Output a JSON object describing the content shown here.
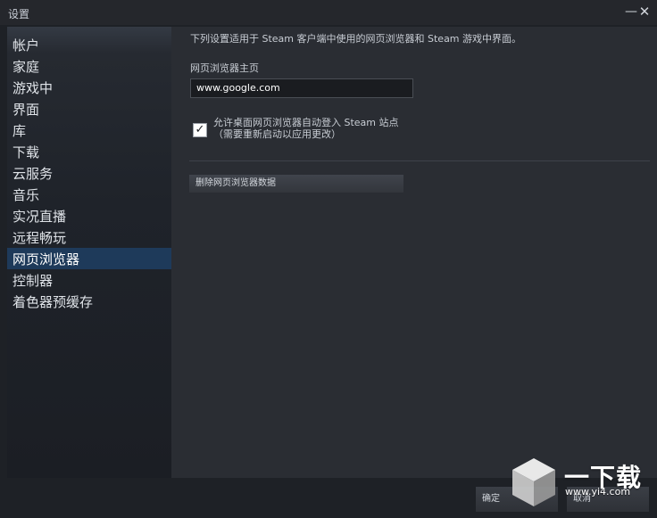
{
  "window": {
    "title": "设置",
    "minimize": "—",
    "close": "✕"
  },
  "sidebar": {
    "items": [
      {
        "label": "帐户"
      },
      {
        "label": "家庭"
      },
      {
        "label": "游戏中"
      },
      {
        "label": "界面"
      },
      {
        "label": "库"
      },
      {
        "label": "下载"
      },
      {
        "label": "云服务"
      },
      {
        "label": "音乐"
      },
      {
        "label": "实况直播"
      },
      {
        "label": "远程畅玩"
      },
      {
        "label": "网页浏览器",
        "active": true
      },
      {
        "label": "控制器"
      },
      {
        "label": "着色器预缓存"
      }
    ]
  },
  "content": {
    "description": "下列设置适用于 Steam 客户端中使用的网页浏览器和 Steam 游戏中界面。",
    "homepage_label": "网页浏览器主页",
    "homepage_value": "www.google.com",
    "checkbox_label_line1": "允许桌面网页浏览器自动登入 Steam 站点",
    "checkbox_label_line2": "（需要重新启动以应用更改）",
    "checkbox_checked": true,
    "clear_button": "删除网页浏览器数据"
  },
  "footer": {
    "ok": "确定",
    "cancel": "取消"
  },
  "watermark": {
    "text": "一下载",
    "url": "www.yi4.com"
  },
  "colors": {
    "active_item": "#1e3a5a",
    "background": "#1e2126",
    "content_bg": "#2a2d33"
  }
}
